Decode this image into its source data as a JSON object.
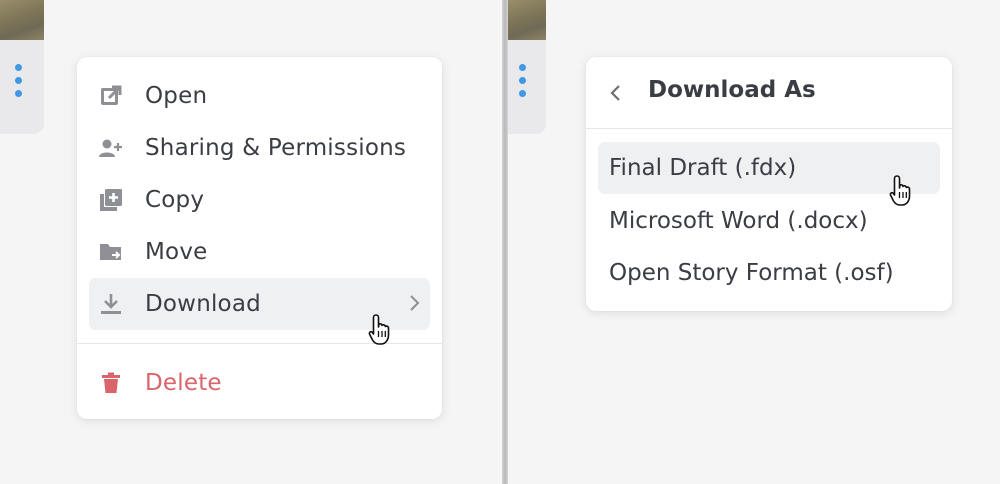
{
  "left_panel": {
    "menu": {
      "items": [
        {
          "label": "Open",
          "icon": "external-link-icon"
        },
        {
          "label": "Sharing & Permissions",
          "icon": "add-user-icon"
        },
        {
          "label": "Copy",
          "icon": "copy-plus-icon"
        },
        {
          "label": "Move",
          "icon": "folder-move-icon"
        },
        {
          "label": "Download",
          "icon": "download-icon",
          "state": "hovered",
          "has_submenu": true
        }
      ],
      "delete": {
        "label": "Delete",
        "icon": "trash-icon",
        "color": "#d9646a"
      }
    }
  },
  "right_panel": {
    "submenu": {
      "title": "Download As",
      "back_icon": "chevron-left-icon",
      "items": [
        {
          "label": "Final Draft (.fdx)",
          "state": "hovered"
        },
        {
          "label": "Microsoft Word (.docx)"
        },
        {
          "label": "Open Story Format (.osf)"
        }
      ]
    }
  },
  "colors": {
    "accent_dots": "#3f97e6",
    "hover_bg": "#eff0f2",
    "danger": "#d9646a",
    "text": "#3a3d44",
    "icon": "#8e9096"
  }
}
